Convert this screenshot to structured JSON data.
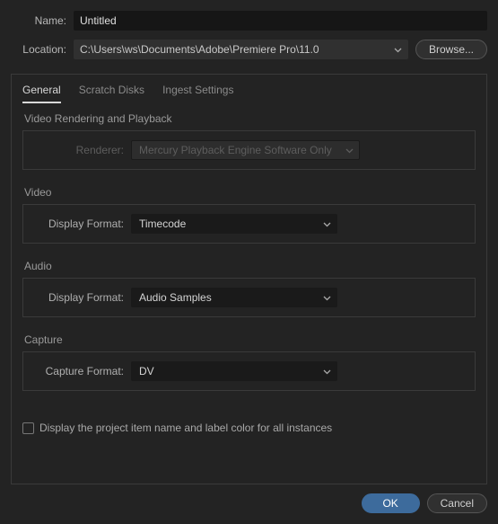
{
  "fields": {
    "name_label": "Name:",
    "name_value": "Untitled",
    "location_label": "Location:",
    "location_value": "C:\\Users\\ws\\Documents\\Adobe\\Premiere Pro\\11.0",
    "browse_label": "Browse..."
  },
  "tabs": [
    {
      "label": "General",
      "active": true
    },
    {
      "label": "Scratch Disks",
      "active": false
    },
    {
      "label": "Ingest Settings",
      "active": false
    }
  ],
  "groups": {
    "rendering": {
      "title": "Video Rendering and Playback",
      "renderer_label": "Renderer:",
      "renderer_value": "Mercury Playback Engine Software Only"
    },
    "video": {
      "title": "Video",
      "display_format_label": "Display Format:",
      "display_format_value": "Timecode"
    },
    "audio": {
      "title": "Audio",
      "display_format_label": "Display Format:",
      "display_format_value": "Audio Samples"
    },
    "capture": {
      "title": "Capture",
      "capture_format_label": "Capture Format:",
      "capture_format_value": "DV"
    }
  },
  "checkbox": {
    "display_item_name": "Display the project item name and label color for all instances",
    "checked": false
  },
  "buttons": {
    "ok": "OK",
    "cancel": "Cancel"
  }
}
